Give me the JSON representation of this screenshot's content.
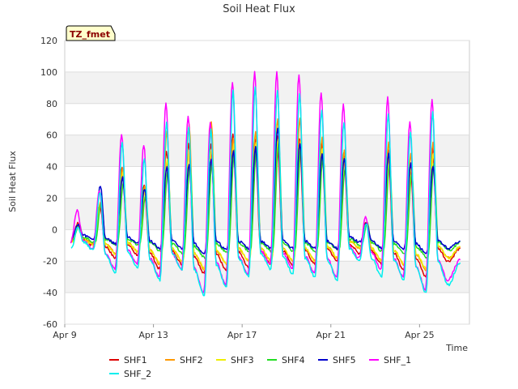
{
  "chart_data": {
    "type": "line",
    "title": "Soil Heat Flux",
    "xlabel": "Time",
    "ylabel": "Soil Heat Flux",
    "badge": "TZ_fmet",
    "ylim": [
      -60,
      120
    ],
    "yticks": [
      -60,
      -40,
      -20,
      0,
      20,
      40,
      60,
      80,
      100,
      120
    ],
    "xlim": [
      "2024-04-09",
      "2024-04-27T06:00"
    ],
    "xticks": [
      {
        "date": "2024-04-09",
        "label": "Apr 9"
      },
      {
        "date": "2024-04-13",
        "label": "Apr 13"
      },
      {
        "date": "2024-04-17",
        "label": "Apr 17"
      },
      {
        "date": "2024-04-21",
        "label": "Apr 21"
      },
      {
        "date": "2024-04-25",
        "label": "Apr 25"
      }
    ],
    "grid": "horizontal bands",
    "legend_position": "bottom",
    "daily_peaks": [
      {
        "date": "2024-04-09",
        "SHF1": 4,
        "SHF2": 3,
        "SHF3": 3,
        "SHF4": 3,
        "SHF5": 3,
        "SHF_1": 12,
        "SHF_2": 2
      },
      {
        "date": "2024-04-10",
        "SHF1": 15,
        "SHF2": 17,
        "SHF3": 16,
        "SHF4": 18,
        "SHF5": 28,
        "SHF_1": 25,
        "SHF_2": 24
      },
      {
        "date": "2024-04-11",
        "SHF1": 40,
        "SHF2": 40,
        "SHF3": 36,
        "SHF4": 30,
        "SHF5": 33,
        "SHF_1": 61,
        "SHF_2": 55
      },
      {
        "date": "2024-04-12",
        "SHF1": 28,
        "SHF2": 28,
        "SHF3": 25,
        "SHF4": 22,
        "SHF5": 26,
        "SHF_1": 54,
        "SHF_2": 45
      },
      {
        "date": "2024-04-13",
        "SHF1": 50,
        "SHF2": 62,
        "SHF3": 45,
        "SHF4": 38,
        "SHF5": 40,
        "SHF_1": 80,
        "SHF_2": 68
      },
      {
        "date": "2024-04-14",
        "SHF1": 55,
        "SHF2": 66,
        "SHF3": 50,
        "SHF4": 42,
        "SHF5": 42,
        "SHF_1": 72,
        "SHF_2": 65
      },
      {
        "date": "2024-04-15",
        "SHF1": 55,
        "SHF2": 69,
        "SHF3": 52,
        "SHF4": 45,
        "SHF5": 45,
        "SHF_1": 68,
        "SHF_2": 64
      },
      {
        "date": "2024-04-16",
        "SHF1": 60,
        "SHF2": 58,
        "SHF3": 55,
        "SHF4": 50,
        "SHF5": 50,
        "SHF_1": 94,
        "SHF_2": 88
      },
      {
        "date": "2024-04-17",
        "SHF1": 58,
        "SHF2": 62,
        "SHF3": 56,
        "SHF4": 52,
        "SHF5": 52,
        "SHF_1": 100,
        "SHF_2": 90
      },
      {
        "date": "2024-04-18",
        "SHF1": 60,
        "SHF2": 70,
        "SHF3": 58,
        "SHF4": 55,
        "SHF5": 65,
        "SHF_1": 100,
        "SHF_2": 89
      },
      {
        "date": "2024-04-19",
        "SHF1": 58,
        "SHF2": 70,
        "SHF3": 56,
        "SHF4": 52,
        "SHF5": 55,
        "SHF_1": 98,
        "SHF_2": 86
      },
      {
        "date": "2024-04-20",
        "SHF1": 55,
        "SHF2": 58,
        "SHF3": 52,
        "SHF4": 48,
        "SHF5": 48,
        "SHF_1": 87,
        "SHF_2": 75
      },
      {
        "date": "2024-04-21",
        "SHF1": 48,
        "SHF2": 50,
        "SHF3": 45,
        "SHF4": 40,
        "SHF5": 45,
        "SHF_1": 79,
        "SHF_2": 68
      },
      {
        "date": "2024-04-22",
        "SHF1": 5,
        "SHF2": 5,
        "SHF3": 4,
        "SHF4": 4,
        "SHF5": 4,
        "SHF_1": 8,
        "SHF_2": 4
      },
      {
        "date": "2024-04-23",
        "SHF1": 50,
        "SHF2": 55,
        "SHF3": 48,
        "SHF4": 42,
        "SHF5": 48,
        "SHF_1": 84,
        "SHF_2": 73
      },
      {
        "date": "2024-04-24",
        "SHF1": 42,
        "SHF2": 48,
        "SHF3": 40,
        "SHF4": 36,
        "SHF5": 42,
        "SHF_1": 68,
        "SHF_2": 62
      },
      {
        "date": "2024-04-25",
        "SHF1": 52,
        "SHF2": 55,
        "SHF3": 48,
        "SHF4": 42,
        "SHF5": 40,
        "SHF_1": 82,
        "SHF_2": 75
      }
    ],
    "daily_troughs": [
      {
        "date": "2024-04-09",
        "SHF1": -8,
        "SHF2": -7,
        "SHF3": -8,
        "SHF4": -6,
        "SHF5": -5,
        "SHF_1": -8,
        "SHF_2": -12
      },
      {
        "date": "2024-04-10",
        "SHF1": -10,
        "SHF2": -9,
        "SHF3": -10,
        "SHF4": -8,
        "SHF5": -6,
        "SHF_1": -12,
        "SHF_2": -13
      },
      {
        "date": "2024-04-11",
        "SHF1": -18,
        "SHF2": -15,
        "SHF3": -16,
        "SHF4": -10,
        "SHF5": -9,
        "SHF_1": -25,
        "SHF_2": -27
      },
      {
        "date": "2024-04-12",
        "SHF1": -16,
        "SHF2": -14,
        "SHF3": -14,
        "SHF4": -10,
        "SHF5": -8,
        "SHF_1": -22,
        "SHF_2": -24
      },
      {
        "date": "2024-04-13",
        "SHF1": -25,
        "SHF2": -22,
        "SHF3": -22,
        "SHF4": -14,
        "SHF5": -12,
        "SHF_1": -30,
        "SHF_2": -32
      },
      {
        "date": "2024-04-14",
        "SHF1": -22,
        "SHF2": -20,
        "SHF3": -20,
        "SHF4": -15,
        "SHF5": -12,
        "SHF_1": -25,
        "SHF_2": -25
      },
      {
        "date": "2024-04-15",
        "SHF1": -28,
        "SHF2": -25,
        "SHF3": -25,
        "SHF4": -18,
        "SHF5": -15,
        "SHF_1": -40,
        "SHF_2": -42
      },
      {
        "date": "2024-04-16",
        "SHF1": -26,
        "SHF2": -22,
        "SHF3": -22,
        "SHF4": -15,
        "SHF5": -13,
        "SHF_1": -35,
        "SHF_2": -37
      },
      {
        "date": "2024-04-17",
        "SHF1": -24,
        "SHF2": -20,
        "SHF3": -20,
        "SHF4": -14,
        "SHF5": -12,
        "SHF_1": -28,
        "SHF_2": -30
      },
      {
        "date": "2024-04-18",
        "SHF1": -22,
        "SHF2": -20,
        "SHF3": -20,
        "SHF4": -14,
        "SHF5": -12,
        "SHF_1": -22,
        "SHF_2": -25
      },
      {
        "date": "2024-04-19",
        "SHF1": -22,
        "SHF2": -20,
        "SHF3": -20,
        "SHF4": -14,
        "SHF5": -12,
        "SHF_1": -25,
        "SHF_2": -28
      },
      {
        "date": "2024-04-20",
        "SHF1": -22,
        "SHF2": -20,
        "SHF3": -20,
        "SHF4": -14,
        "SHF5": -12,
        "SHF_1": -28,
        "SHF_2": -30
      },
      {
        "date": "2024-04-21",
        "SHF1": -20,
        "SHF2": -18,
        "SHF3": -18,
        "SHF4": -13,
        "SHF5": -12,
        "SHF_1": -30,
        "SHF_2": -32
      },
      {
        "date": "2024-04-22",
        "SHF1": -15,
        "SHF2": -12,
        "SHF3": -12,
        "SHF4": -10,
        "SHF5": -8,
        "SHF_1": -18,
        "SHF_2": -20
      },
      {
        "date": "2024-04-23",
        "SHF1": -22,
        "SHF2": -20,
        "SHF3": -20,
        "SHF4": -14,
        "SHF5": -12,
        "SHF_1": -25,
        "SHF_2": -30
      },
      {
        "date": "2024-04-24",
        "SHF1": -25,
        "SHF2": -22,
        "SHF3": -22,
        "SHF4": -15,
        "SHF5": -12,
        "SHF_1": -30,
        "SHF_2": -32
      },
      {
        "date": "2024-04-25",
        "SHF1": -30,
        "SHF2": -26,
        "SHF3": -25,
        "SHF4": -18,
        "SHF5": -15,
        "SHF_1": -38,
        "SHF_2": -40
      },
      {
        "date": "2024-04-26",
        "SHF1": -20,
        "SHF2": -18,
        "SHF3": -18,
        "SHF4": -13,
        "SHF5": -12,
        "SHF_1": -32,
        "SHF_2": -35
      }
    ],
    "series": [
      {
        "name": "SHF1",
        "color": "#dd0000"
      },
      {
        "name": "SHF2",
        "color": "#ff9900"
      },
      {
        "name": "SHF3",
        "color": "#eeee00"
      },
      {
        "name": "SHF4",
        "color": "#22dd22"
      },
      {
        "name": "SHF5",
        "color": "#0000cc"
      },
      {
        "name": "SHF_1",
        "color": "#ff00ff"
      },
      {
        "name": "SHF_2",
        "color": "#00eeee"
      }
    ]
  }
}
